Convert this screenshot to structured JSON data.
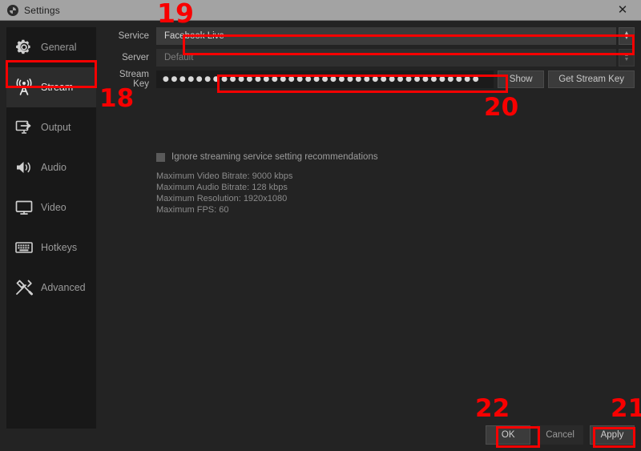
{
  "window": {
    "title": "Settings",
    "icon": "obs-logo-icon",
    "close_label": "✕"
  },
  "sidebar": {
    "items": [
      {
        "label": "General",
        "icon": "gear-icon",
        "active": false
      },
      {
        "label": "Stream",
        "icon": "stream-icon",
        "active": true
      },
      {
        "label": "Output",
        "icon": "output-icon",
        "active": false
      },
      {
        "label": "Audio",
        "icon": "speaker-icon",
        "active": false
      },
      {
        "label": "Video",
        "icon": "monitor-icon",
        "active": false
      },
      {
        "label": "Hotkeys",
        "icon": "keyboard-icon",
        "active": false
      },
      {
        "label": "Advanced",
        "icon": "tools-icon",
        "active": false
      }
    ]
  },
  "form": {
    "service": {
      "label": "Service",
      "value": "Facebook Live"
    },
    "server": {
      "label": "Server",
      "value": "Default"
    },
    "stream_key": {
      "label": "Stream Key",
      "masked_value": "●●●●●●●●●●●●●●●●●●●●●●●●●●●●●●●●●●●●●●",
      "show_button": "Show",
      "get_key_button": "Get Stream Key"
    },
    "ignore_recommendations": {
      "label": "Ignore streaming service setting recommendations",
      "checked": false
    },
    "info_lines": [
      "Maximum Video Bitrate: 9000 kbps",
      "Maximum Audio Bitrate: 128 kbps",
      "Maximum Resolution: 1920x1080",
      "Maximum FPS: 60"
    ]
  },
  "footer": {
    "ok": "OK",
    "cancel": "Cancel",
    "apply": "Apply"
  },
  "annotations": {
    "step_18": "18",
    "step_19": "19",
    "step_20": "20",
    "step_21": "21",
    "step_22": "22",
    "color": "#f80000"
  }
}
